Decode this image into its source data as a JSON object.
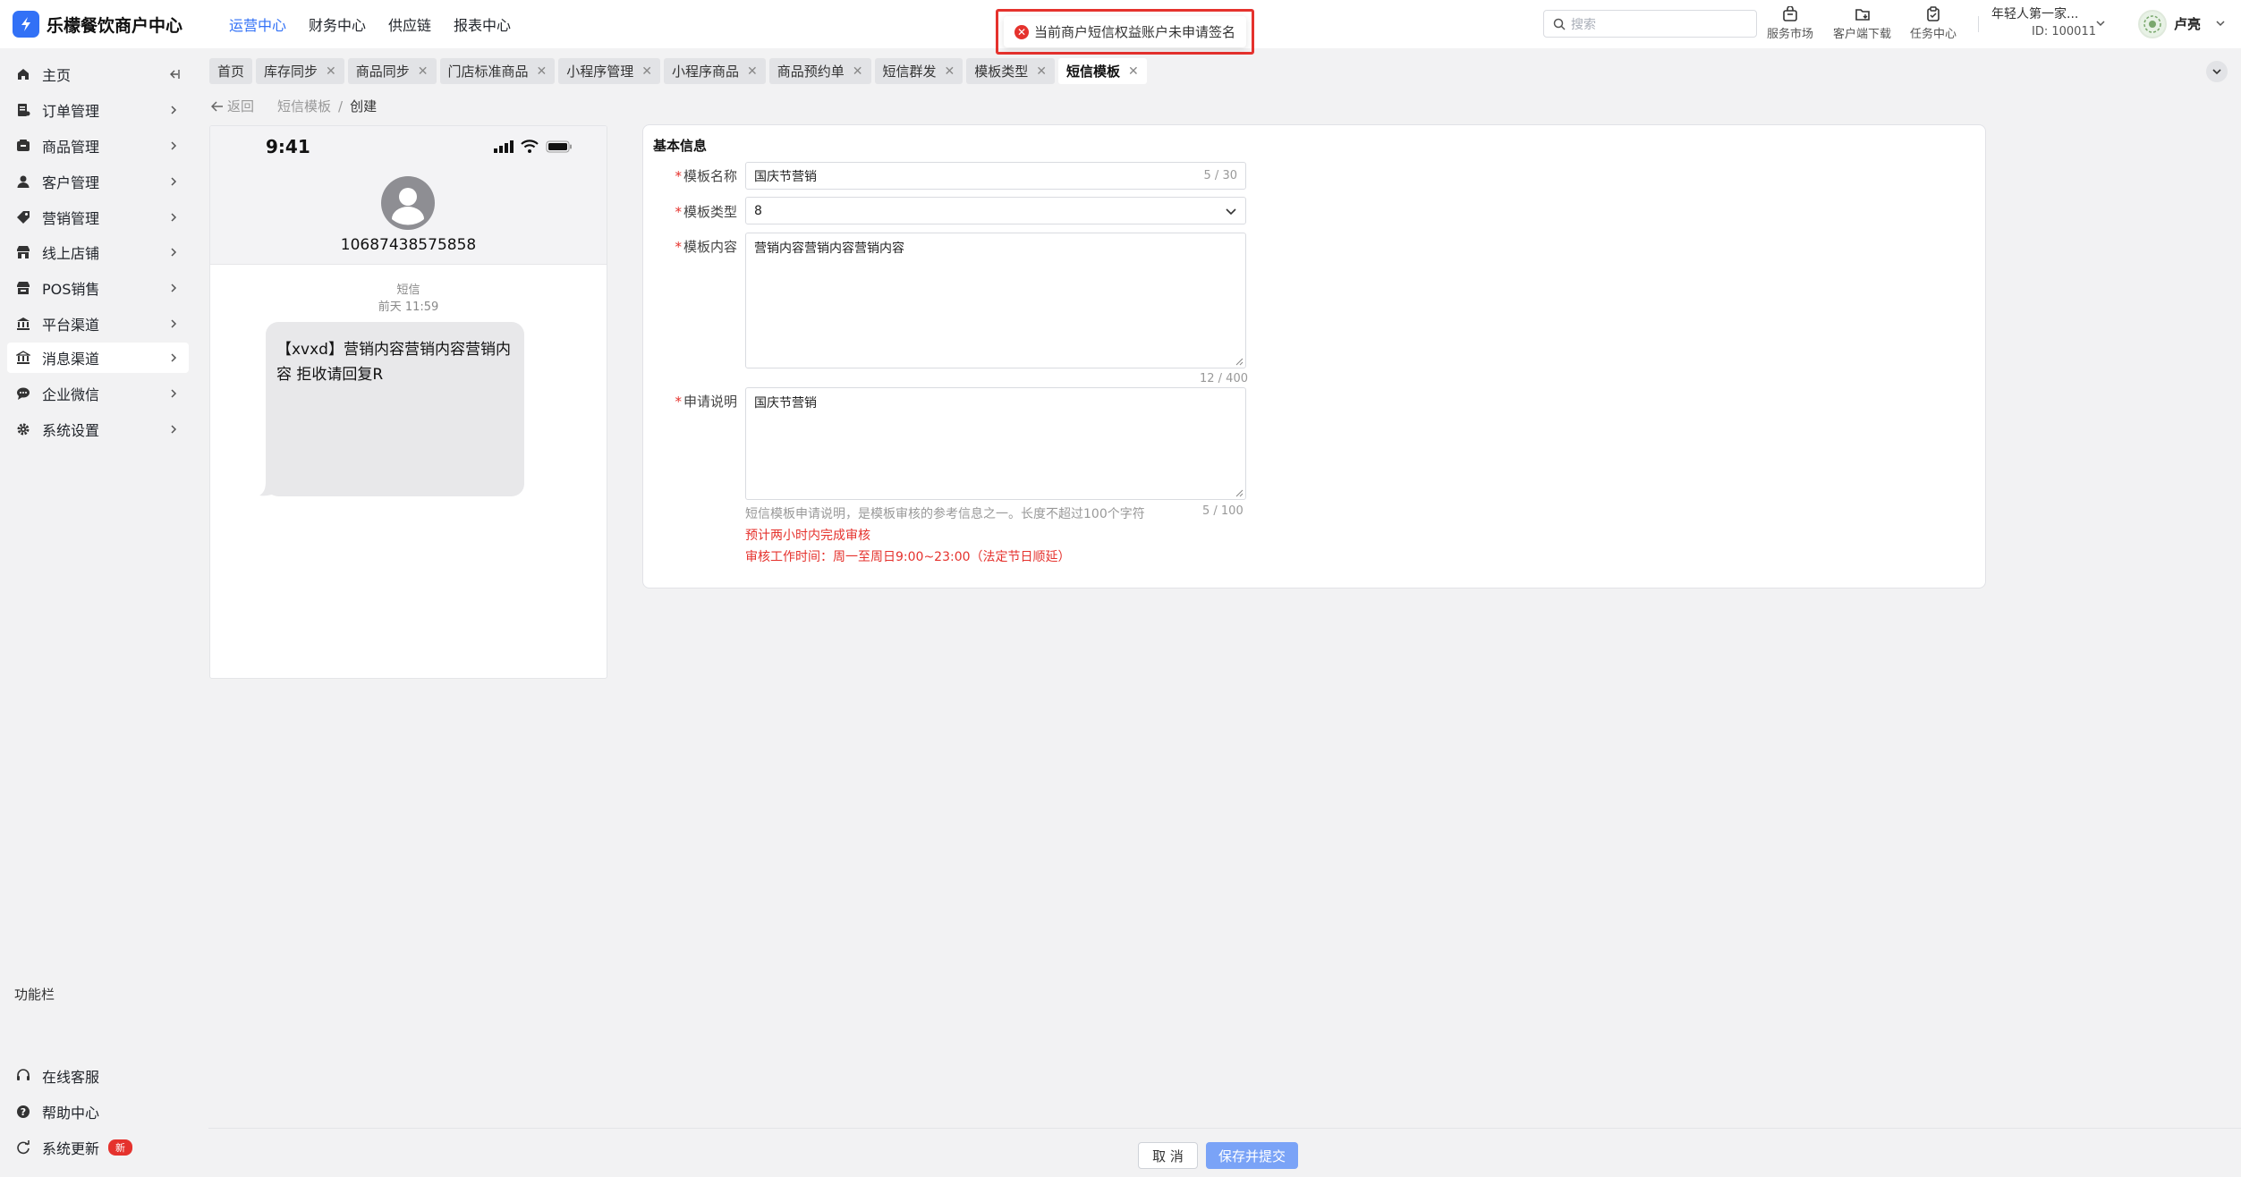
{
  "header": {
    "app_title": "乐檬餐饮商户中心",
    "nav": [
      "运营中心",
      "财务中心",
      "供应链",
      "报表中心"
    ],
    "active_nav": "运营中心",
    "alert_text": "当前商户短信权益账户未申请签名",
    "search_placeholder": "搜索",
    "tools": [
      "服务市场",
      "客户端下载",
      "任务中心"
    ],
    "account_name": "年轻人第一家...",
    "account_id": "ID: 100011",
    "username": "卢亮"
  },
  "sidebar": {
    "items": [
      {
        "label": "主页",
        "icon": "home-icon"
      },
      {
        "label": "订单管理",
        "icon": "order-icon"
      },
      {
        "label": "商品管理",
        "icon": "goods-icon"
      },
      {
        "label": "客户管理",
        "icon": "user-icon"
      },
      {
        "label": "营销管理",
        "icon": "tag-icon"
      },
      {
        "label": "线上店铺",
        "icon": "store-icon"
      },
      {
        "label": "POS销售",
        "icon": "pos-icon"
      },
      {
        "label": "平台渠道",
        "icon": "bank-icon"
      },
      {
        "label": "消息渠道",
        "icon": "message-icon"
      },
      {
        "label": "企业微信",
        "icon": "chat-icon"
      },
      {
        "label": "系统设置",
        "icon": "gear-icon"
      }
    ],
    "active_item": "消息渠道",
    "section_title": "功能栏",
    "bottom_items": [
      {
        "label": "在线客服",
        "icon": "headset-icon"
      },
      {
        "label": "帮助中心",
        "icon": "help-icon"
      },
      {
        "label": "系统更新",
        "icon": "refresh-icon",
        "badge": "新"
      }
    ]
  },
  "tabs": [
    {
      "label": "首页",
      "closable": false
    },
    {
      "label": "库存同步",
      "closable": true
    },
    {
      "label": "商品同步",
      "closable": true
    },
    {
      "label": "门店标准商品",
      "closable": true
    },
    {
      "label": "小程序管理",
      "closable": true
    },
    {
      "label": "小程序商品",
      "closable": true
    },
    {
      "label": "商品预约单",
      "closable": true
    },
    {
      "label": "短信群发",
      "closable": true
    },
    {
      "label": "模板类型",
      "closable": true
    },
    {
      "label": "短信模板",
      "closable": true,
      "active": true
    }
  ],
  "breadcrumb": {
    "back": "返回",
    "parent": "短信模板",
    "separator": "/",
    "current": "创建"
  },
  "phone": {
    "time": "9:41",
    "number": "10687438575858",
    "message_type": "短信",
    "message_time": "前天 11:59",
    "message_text": "【xvxd】营销内容营销内容营销内容 拒收请回复R"
  },
  "form": {
    "section_title": "基本信息",
    "name_label": "模板名称",
    "name_value": "国庆节营销",
    "name_counter": "5 / 30",
    "type_label": "模板类型",
    "type_value": "8",
    "content_label": "模板内容",
    "content_value": "营销内容营销内容营销内容",
    "content_counter": "12 / 400",
    "desc_label": "申请说明",
    "desc_value": "国庆节营销",
    "desc_counter": "5 / 100",
    "desc_help": "短信模板申请说明，是模板审核的参考信息之一。长度不超过100个字符",
    "notice_1": "预计两小时内完成审核",
    "notice_2": "审核工作时间：周一至周日9:00~23:00（法定节日顺延）"
  },
  "footer": {
    "cancel": "取 消",
    "submit": "保存并提交"
  },
  "colors": {
    "primary": "#3271f6",
    "danger": "#e5322d",
    "submit_disabled": "#7aa3f7"
  }
}
